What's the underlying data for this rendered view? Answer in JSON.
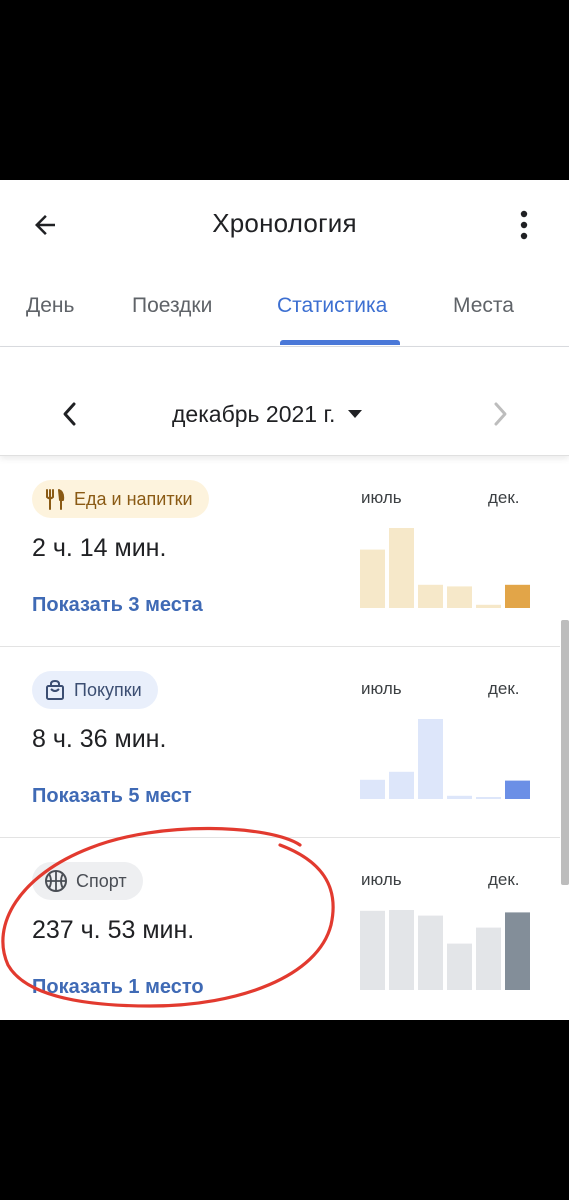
{
  "header": {
    "title": "Хронология"
  },
  "tabs": [
    {
      "label": "День",
      "active": false
    },
    {
      "label": "Поездки",
      "active": false
    },
    {
      "label": "Статистика",
      "active": true
    },
    {
      "label": "Места",
      "active": false
    }
  ],
  "period": {
    "label": "декабрь 2021 г."
  },
  "cards": [
    {
      "category": "Еда и напитки",
      "icon": "fork-knife-icon",
      "duration": "2 ч. 14 мин.",
      "link": "Показать 3 места",
      "axis_start": "июль",
      "axis_end": "дек.",
      "chip_bg": "#fdf3dd",
      "chip_fg": "#8a5a14",
      "bar_color": "#f6e8c9",
      "highlight_color": "#e2a548",
      "bars": [
        0.73,
        1.0,
        0.29,
        0.27,
        0.04,
        0.29
      ]
    },
    {
      "category": "Покупки",
      "icon": "shopping-bag-icon",
      "duration": "8 ч. 36 мин.",
      "link": "Показать 5 мест",
      "axis_start": "июль",
      "axis_end": "дек.",
      "chip_bg": "#e9effb",
      "chip_fg": "#3c4e72",
      "bar_color": "#dde6fa",
      "highlight_color": "#6b8fe6",
      "bars": [
        0.24,
        0.34,
        1.0,
        0.04,
        0.02,
        0.23
      ]
    },
    {
      "category": "Спорт",
      "icon": "basketball-icon",
      "duration": "237 ч. 53 мин.",
      "link": "Показать 1 место",
      "axis_start": "июль",
      "axis_end": "дек.",
      "chip_bg": "#eeeff1",
      "chip_fg": "#4a4e55",
      "bar_color": "#e3e5e8",
      "highlight_color": "#838e99",
      "bars": [
        0.99,
        1.0,
        0.93,
        0.58,
        0.78,
        0.97
      ]
    }
  ],
  "colors": {
    "accent": "#4a78d8",
    "annotation": "#e23a2f"
  }
}
